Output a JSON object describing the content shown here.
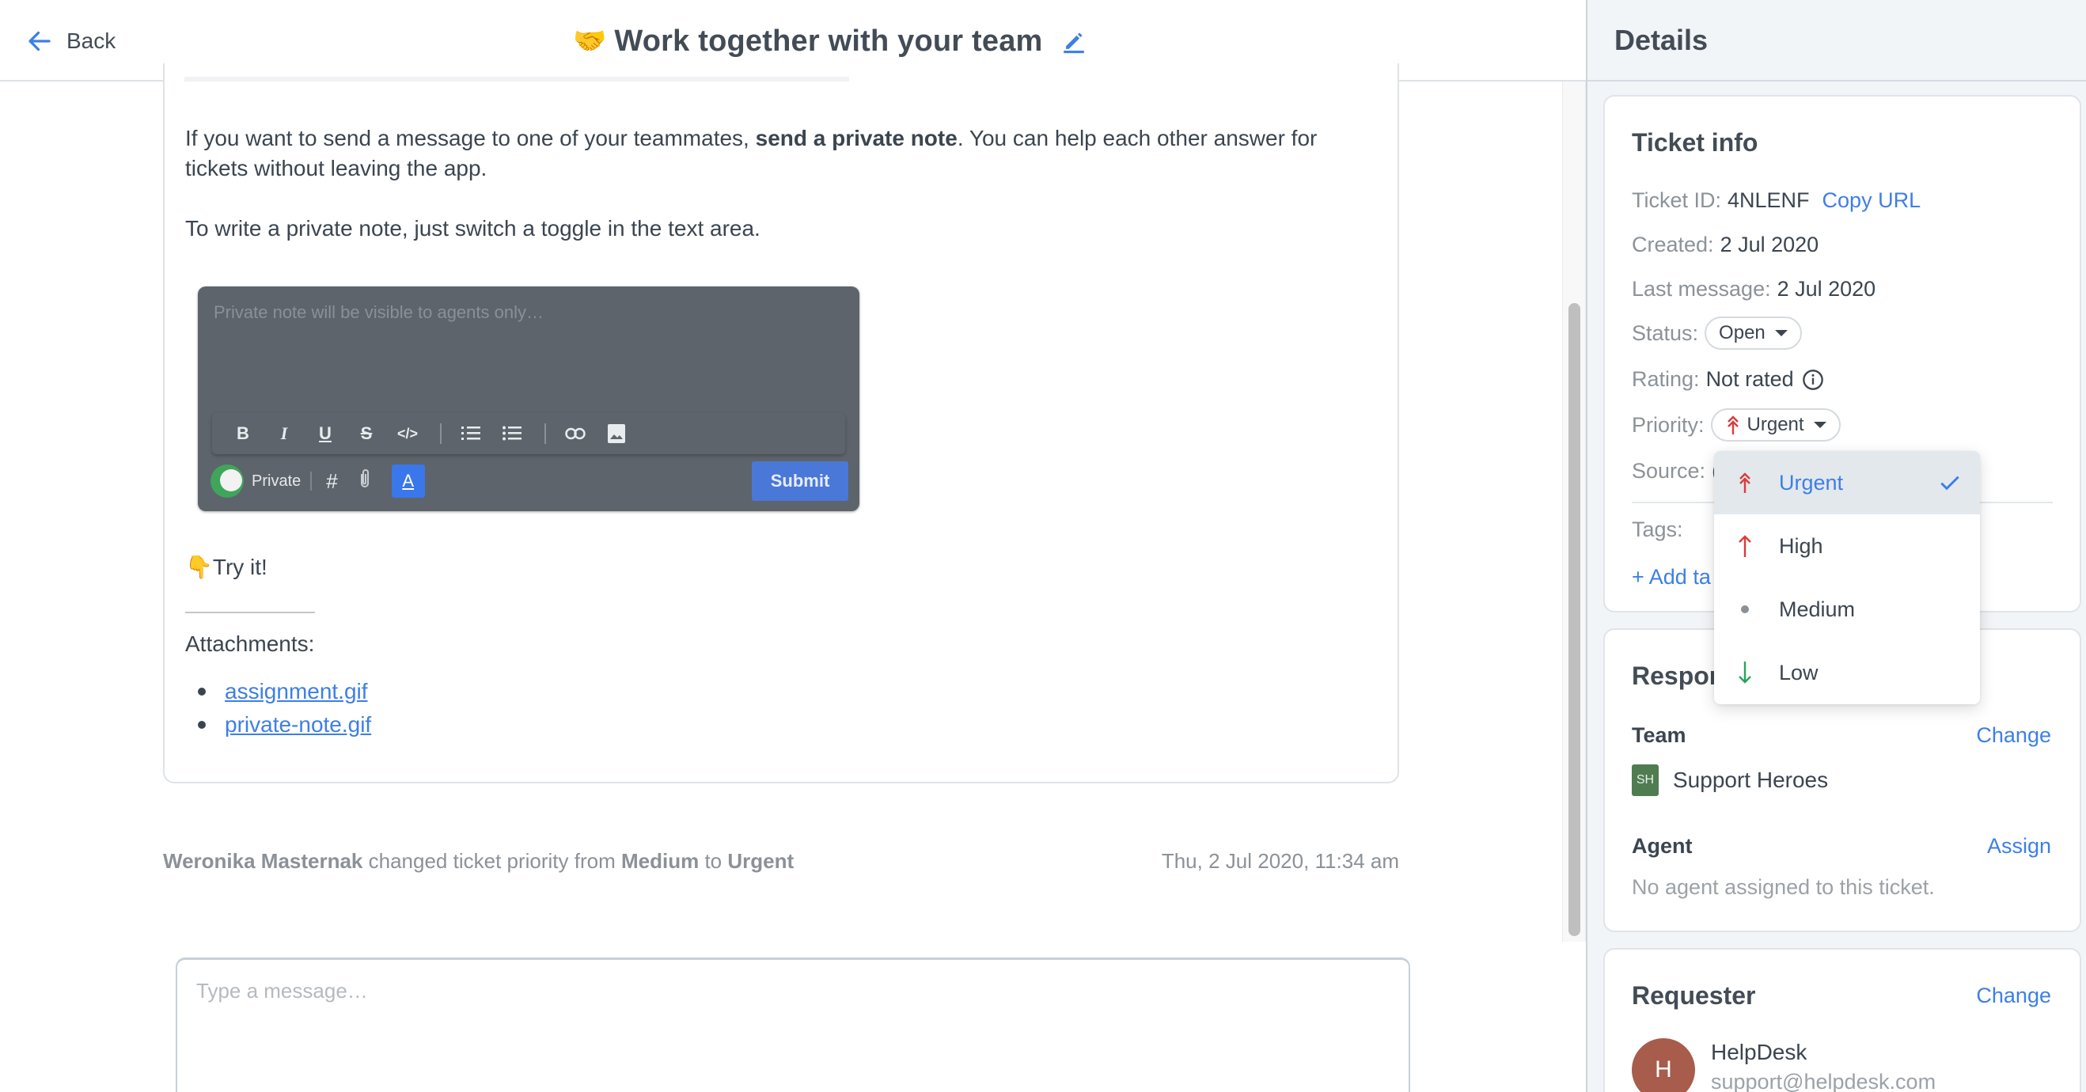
{
  "header": {
    "back_label": "Back",
    "title_emoji": "🤝",
    "title": "Work together with your team"
  },
  "message": {
    "paragraph1_before": "If you want to send a message to one of your teammates, ",
    "paragraph1_bold": "send a private note",
    "paragraph1_after": ". You can help each other answer for tickets without leaving the app.",
    "paragraph2": "To write a private note, just switch a toggle in the text area.",
    "demo": {
      "placeholder": "Private note will be visible to agents only…",
      "toolbar": [
        "bold",
        "italic",
        "underline",
        "strikethrough",
        "code",
        "ordered-list",
        "bullet-list",
        "link",
        "image"
      ],
      "private_label": "Private",
      "submit_label": "Submit"
    },
    "try_it_emoji": "👇",
    "try_it": "Try it!",
    "attachments_label": "Attachments:",
    "attachments": [
      "assignment.gif",
      "private-note.gif"
    ]
  },
  "activity": {
    "actor": "Weronika Masternak",
    "text1": " changed ticket priority from ",
    "from": "Medium",
    "text2": " to ",
    "to": "Urgent",
    "timestamp": "Thu, 2 Jul 2020, 11:34 am"
  },
  "composer": {
    "placeholder": "Type a message…",
    "value": ""
  },
  "sidebar": {
    "title": "Details",
    "ticket_info": {
      "title": "Ticket info",
      "ticket_id_label": "Ticket ID:",
      "ticket_id": "4NLENF",
      "copy_url": "Copy URL",
      "created_label": "Created:",
      "created": "2 Jul 2020",
      "last_message_label": "Last message:",
      "last_message": "2 Jul 2020",
      "status_label": "Status:",
      "status": "Open",
      "rating_label": "Rating:",
      "rating": "Not rated",
      "priority_label": "Priority:",
      "priority": "Urgent",
      "source_label": "Source:",
      "source_partial": "(",
      "tags_label": "Tags:",
      "add_tag": "+ Add ta"
    },
    "responsibility": {
      "title_partial": "Respor",
      "team_label": "Team",
      "team_change": "Change",
      "team_initials": "SH",
      "team_name": "Support Heroes",
      "agent_label": "Agent",
      "agent_assign": "Assign",
      "agent_empty": "No agent assigned to this ticket."
    },
    "requester": {
      "title": "Requester",
      "change": "Change",
      "initial": "H",
      "name": "HelpDesk",
      "email": "support@helpdesk.com"
    }
  },
  "priority_dropdown": {
    "selected": "Urgent",
    "options": [
      {
        "label": "Urgent",
        "icon": "double-arrow-up-icon",
        "color": "#d93c3c"
      },
      {
        "label": "High",
        "icon": "arrow-up-icon",
        "color": "#d93c3c"
      },
      {
        "label": "Medium",
        "icon": "dot-icon",
        "color": "#8a9096"
      },
      {
        "label": "Low",
        "icon": "arrow-down-icon",
        "color": "#27a55a"
      }
    ]
  },
  "colors": {
    "accent": "#3d7fe6",
    "urgent": "#d93c3c",
    "low": "#27a55a",
    "team_badge": "#4f7c51",
    "avatar": "#a85c4b"
  }
}
